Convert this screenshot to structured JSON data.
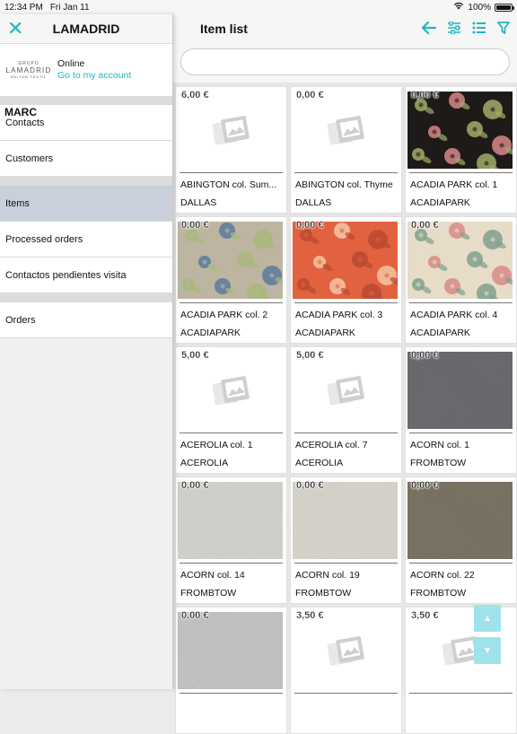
{
  "status": {
    "time": "12:34 PM",
    "date": "Fri Jan 11",
    "battery": "100%"
  },
  "sidebar": {
    "title": "LAMADRID",
    "logo": {
      "line1": "GRUPO",
      "line2": "LAMADRID",
      "line3": "EDITOR TEXTIL"
    },
    "profile": {
      "name": "MARC",
      "status": "Online",
      "link": "Go to my account"
    },
    "items": [
      {
        "label": "Contacts",
        "group": 1
      },
      {
        "label": "Customers",
        "group": 1
      },
      {
        "label": "Items",
        "group": 2,
        "active": true
      },
      {
        "label": "Processed orders",
        "group": 2
      },
      {
        "label": "Contactos pendientes visita",
        "group": 2
      },
      {
        "label": "Orders",
        "group": 3
      }
    ]
  },
  "main": {
    "title": "Item list",
    "search": {
      "value": "",
      "placeholder": ""
    },
    "header_icons": [
      "back-arrow-icon",
      "sliders-icon",
      "list-view-icon",
      "filter-icon"
    ]
  },
  "items": [
    {
      "price": "6,00 €",
      "name": "ABINGTON col. Sum...",
      "collection": "DALLAS",
      "image": "placeholder"
    },
    {
      "price": "0,00 €",
      "name": "ABINGTON col. Thyme",
      "collection": "DALLAS",
      "image": "placeholder"
    },
    {
      "price": "0,00 €",
      "name": "ACADIA PARK col. 1",
      "collection": "ACADIAPARK",
      "image": "floral",
      "bg": "#1e1a17",
      "accent1": "#d9878a",
      "accent2": "#a0ad6a"
    },
    {
      "price": "0,00 €",
      "name": "ACADIA PARK col. 2",
      "collection": "ACADIAPARK",
      "image": "floral",
      "bg": "#bdb4a2",
      "accent1": "#5a7a9c",
      "accent2": "#a8b97a"
    },
    {
      "price": "0,00 €",
      "name": "ACADIA PARK col. 3",
      "collection": "ACADIAPARK",
      "image": "floral",
      "bg": "#e2623f",
      "accent1": "#f3c7a4",
      "accent2": "#b84a32"
    },
    {
      "price": "0,00 €",
      "name": "ACADIA PARK col. 4",
      "collection": "ACADIAPARK",
      "image": "floral",
      "bg": "#e6dcc8",
      "accent1": "#d88a85",
      "accent2": "#7fa08c"
    },
    {
      "price": "5,00 €",
      "name": "ACEROLIA col. 1",
      "collection": "ACEROLIA",
      "image": "placeholder"
    },
    {
      "price": "5,00 €",
      "name": "ACEROLIA col. 7",
      "collection": "ACEROLIA",
      "image": "placeholder"
    },
    {
      "price": "0,00 €",
      "name": "ACORN col. 1",
      "collection": "FROMBTOW",
      "image": "fabric",
      "bg": "#66686b"
    },
    {
      "price": "0,00 €",
      "name": "ACORN col. 14",
      "collection": "FROMBTOW",
      "image": "fabric",
      "bg": "#d3d1cd"
    },
    {
      "price": "0,00 €",
      "name": "ACORN col. 19",
      "collection": "FROMBTOW",
      "image": "fabric",
      "bg": "#d7d3cb"
    },
    {
      "price": "0,00 €",
      "name": "ACORN col. 22",
      "collection": "FROMBTOW",
      "image": "fabric",
      "bg": "#78705f"
    },
    {
      "price": "0,00 €",
      "name": "",
      "collection": "",
      "image": "fabric",
      "bg": "#c2c2c2"
    },
    {
      "price": "3,50 €",
      "name": "",
      "collection": "",
      "image": "placeholder"
    },
    {
      "price": "3,50 €",
      "name": "",
      "collection": "",
      "image": "placeholder"
    }
  ],
  "scroll": {
    "up": "▲",
    "down": "▼"
  },
  "colors": {
    "accent": "#1fb6c4",
    "active_menu": "#c9d0dc"
  }
}
